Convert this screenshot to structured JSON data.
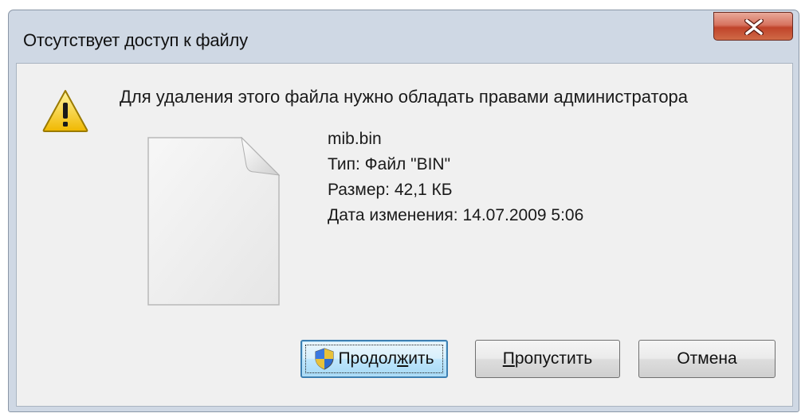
{
  "window": {
    "title": "Отсутствует доступ к файлу",
    "close_icon": "close-x-icon"
  },
  "message": "Для удаления этого файла нужно обладать правами администратора",
  "file": {
    "name": "mib.bin",
    "type": "Тип: Файл \"BIN\"",
    "size": "Размер: 42,1 КБ",
    "modified": "Дата изменения: 14.07.2009 5:06"
  },
  "buttons": {
    "continue": {
      "before": "Продол",
      "mnemonic": "ж",
      "after": "ить",
      "icon": "uac-shield-icon"
    },
    "skip": {
      "mnemonic": "П",
      "after": "ропустить"
    },
    "cancel": "Отмена"
  },
  "colors": {
    "close_button": "#c0442a",
    "default_button_border": "#3c7fb1",
    "warning_yellow": "#f7d01c"
  }
}
